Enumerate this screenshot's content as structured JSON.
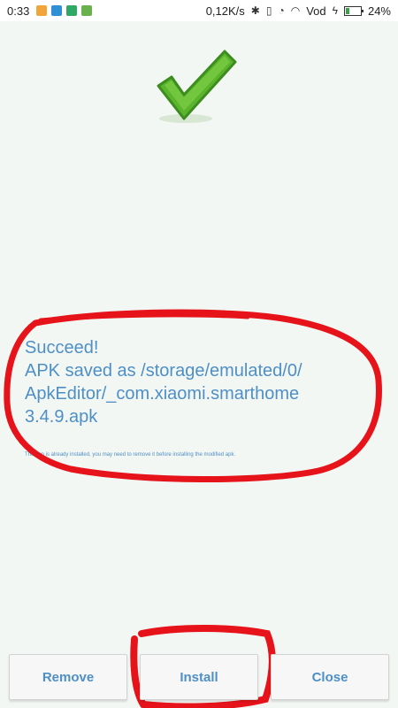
{
  "status_bar": {
    "time": "0:33",
    "speed": "0,12K/s",
    "carrier": "Vod",
    "battery": "24%",
    "battery_level": 0.24,
    "notification_icons": [
      "orange-app-icon",
      "skype-icon",
      "green-app-icon",
      "android-icon"
    ]
  },
  "message": {
    "lines": [
      "Succeed!",
      "APK saved as /storage/emulated/0/",
      "ApkEditor/_com.xiaomi.smarthome",
      "3.4.9.apk"
    ],
    "note": "The app is already installed, you may need to remove it before installing the modified apk."
  },
  "buttons": {
    "remove": "Remove",
    "install": "Install",
    "close": "Close"
  },
  "colors": {
    "text": "#4e8fc6",
    "check": "#5ab52c",
    "annotation": "#e6131a"
  }
}
